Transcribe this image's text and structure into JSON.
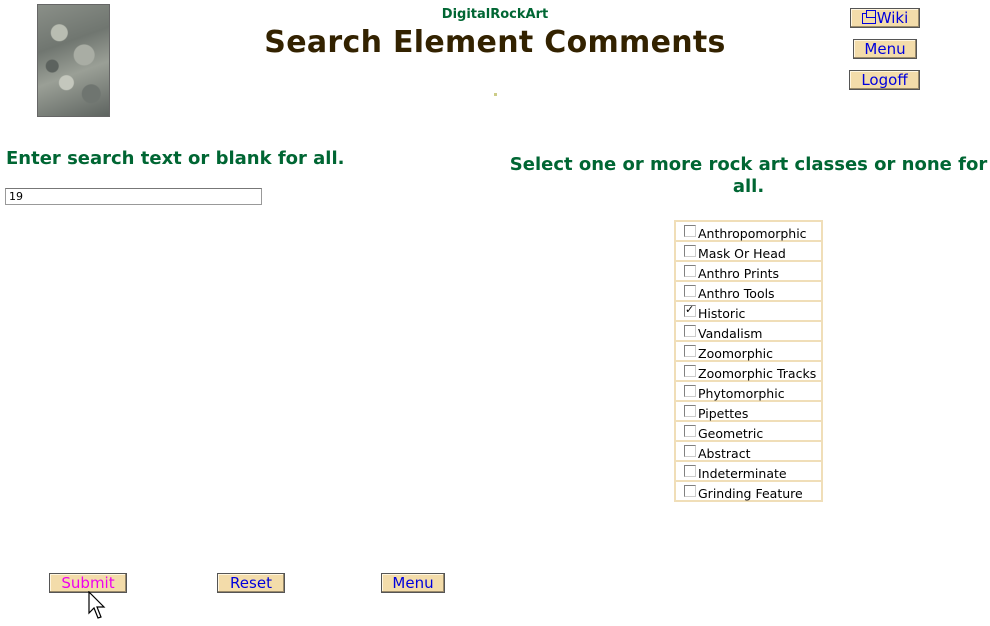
{
  "header": {
    "site_name": "DigitalRockArt",
    "title": "Search Element Comments",
    "wiki_label": "Wiki",
    "menu_label": "Menu",
    "logoff_label": "Logoff"
  },
  "search": {
    "heading": "Enter search text or blank for all.",
    "value": "19"
  },
  "classes": {
    "heading": "Select one or more rock art classes or none for all.",
    "items": [
      {
        "label": "Anthropomorphic",
        "checked": false
      },
      {
        "label": "Mask Or Head",
        "checked": false
      },
      {
        "label": "Anthro Prints",
        "checked": false
      },
      {
        "label": "Anthro Tools",
        "checked": false
      },
      {
        "label": "Historic",
        "checked": true
      },
      {
        "label": "Vandalism",
        "checked": false
      },
      {
        "label": "Zoomorphic",
        "checked": false
      },
      {
        "label": "Zoomorphic Tracks",
        "checked": false
      },
      {
        "label": "Phytomorphic",
        "checked": false
      },
      {
        "label": "Pipettes",
        "checked": false
      },
      {
        "label": "Geometric",
        "checked": false
      },
      {
        "label": "Abstract",
        "checked": false
      },
      {
        "label": "Indeterminate",
        "checked": false
      },
      {
        "label": "Grinding Feature",
        "checked": false
      }
    ]
  },
  "actions": {
    "submit_label": "Submit",
    "reset_label": "Reset",
    "menu_label": "Menu"
  },
  "colors": {
    "heading_green": "#006633",
    "title_brown": "#332200",
    "button_bg": "#f3dcaa",
    "button_text": "#0000dd",
    "submit_text": "#ee00ee"
  }
}
